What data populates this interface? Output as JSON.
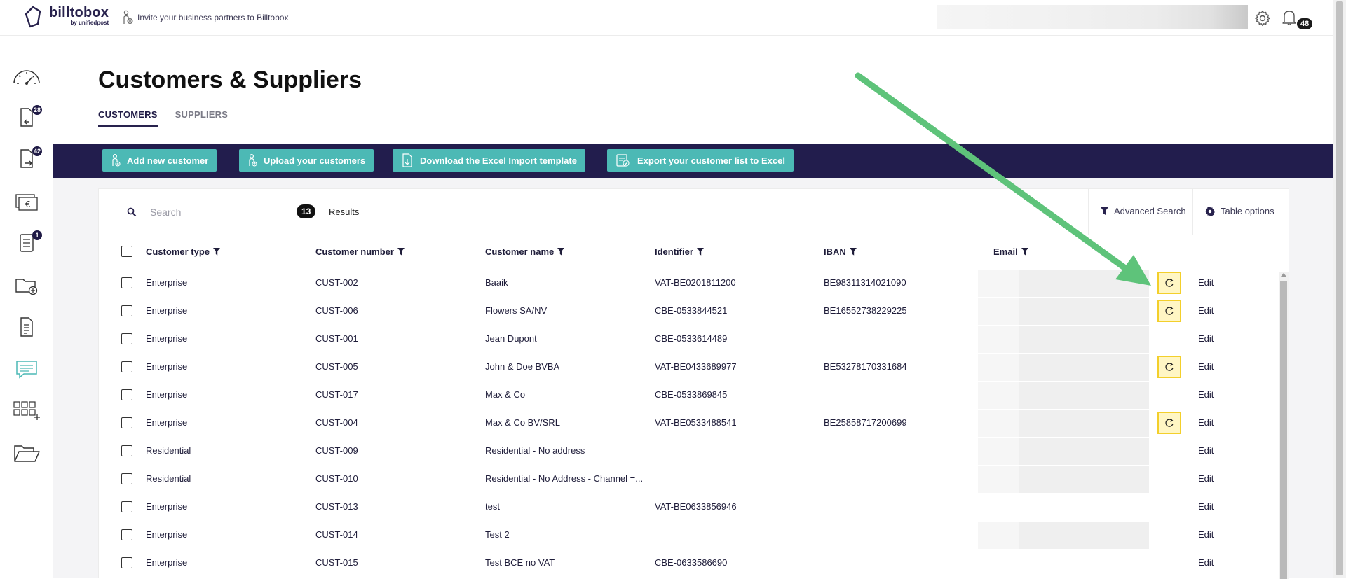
{
  "brand": {
    "name": "billtobox",
    "sub": "by unifiedpost"
  },
  "topbar": {
    "invite_text": "Invite your business partners to Billtobox",
    "notification_count": "48"
  },
  "sidebar": {
    "items": [
      {
        "icon": "dashboard-gauge-icon",
        "badge": ""
      },
      {
        "icon": "incoming-documents-icon",
        "badge": "28"
      },
      {
        "icon": "outgoing-documents-icon",
        "badge": "42"
      },
      {
        "icon": "payments-euro-icon",
        "badge": ""
      },
      {
        "icon": "tasks-list-icon",
        "badge": "1"
      },
      {
        "icon": "add-folder-icon",
        "badge": ""
      },
      {
        "icon": "report-document-icon",
        "badge": ""
      },
      {
        "icon": "messages-icon",
        "badge": ""
      },
      {
        "icon": "apps-grid-icon",
        "badge": ""
      },
      {
        "icon": "open-folder-icon",
        "badge": ""
      }
    ]
  },
  "page": {
    "title": "Customers & Suppliers",
    "tabs": [
      "CUSTOMERS",
      "SUPPLIERS"
    ],
    "active_tab": "CUSTOMERS"
  },
  "actions": {
    "add_new": "Add new customer",
    "upload": "Upload your customers",
    "download_template": "Download the Excel Import template",
    "export": "Export your customer list to Excel"
  },
  "toolbar": {
    "search_placeholder": "Search",
    "results_count": "13",
    "results_label": "Results",
    "advanced_search": "Advanced Search",
    "table_options": "Table options"
  },
  "table": {
    "columns": [
      "Customer type",
      "Customer number",
      "Customer name",
      "Identifier",
      "IBAN",
      "Email"
    ],
    "edit_label": "Edit",
    "rows": [
      {
        "type": "Enterprise",
        "number": "CUST-002",
        "name": "Baaik",
        "identifier": "VAT-BE0201811200",
        "iban": "BE98311314021090",
        "sync": true,
        "email_hidden": true
      },
      {
        "type": "Enterprise",
        "number": "CUST-006",
        "name": "Flowers SA/NV",
        "identifier": "CBE-0533844521",
        "iban": "BE16552738229225",
        "sync": true,
        "email_hidden": true
      },
      {
        "type": "Enterprise",
        "number": "CUST-001",
        "name": "Jean Dupont",
        "identifier": "CBE-0533614489",
        "iban": "",
        "sync": false,
        "email_hidden": true
      },
      {
        "type": "Enterprise",
        "number": "CUST-005",
        "name": "John & Doe BVBA",
        "identifier": "VAT-BE0433689977",
        "iban": "BE53278170331684",
        "sync": true,
        "email_hidden": true
      },
      {
        "type": "Enterprise",
        "number": "CUST-017",
        "name": "Max & Co",
        "identifier": "CBE-0533869845",
        "iban": "",
        "sync": false,
        "email_hidden": true
      },
      {
        "type": "Enterprise",
        "number": "CUST-004",
        "name": "Max & Co BV/SRL",
        "identifier": "VAT-BE0533488541",
        "iban": "BE25858717200699",
        "sync": true,
        "email_hidden": true
      },
      {
        "type": "Residential",
        "number": "CUST-009",
        "name": "Residential - No address",
        "identifier": "",
        "iban": "",
        "sync": false,
        "email_hidden": true
      },
      {
        "type": "Residential",
        "number": "CUST-010",
        "name": "Residential - No Address - Channel =...",
        "identifier": "",
        "iban": "",
        "sync": false,
        "email_hidden": true
      },
      {
        "type": "Enterprise",
        "number": "CUST-013",
        "name": "test",
        "identifier": "VAT-BE0633856946",
        "iban": "",
        "sync": false,
        "email_hidden": false
      },
      {
        "type": "Enterprise",
        "number": "CUST-014",
        "name": "Test 2",
        "identifier": "",
        "iban": "",
        "sync": false,
        "email_hidden": true
      },
      {
        "type": "Enterprise",
        "number": "CUST-015",
        "name": "Test BCE no VAT",
        "identifier": "CBE-0633586690",
        "iban": "",
        "sync": false,
        "email_hidden": false
      }
    ]
  },
  "colors": {
    "navy": "#221d4d",
    "teal": "#4cb9b5",
    "highlight": "#f3cf2b",
    "arrow": "#5ec37a"
  }
}
